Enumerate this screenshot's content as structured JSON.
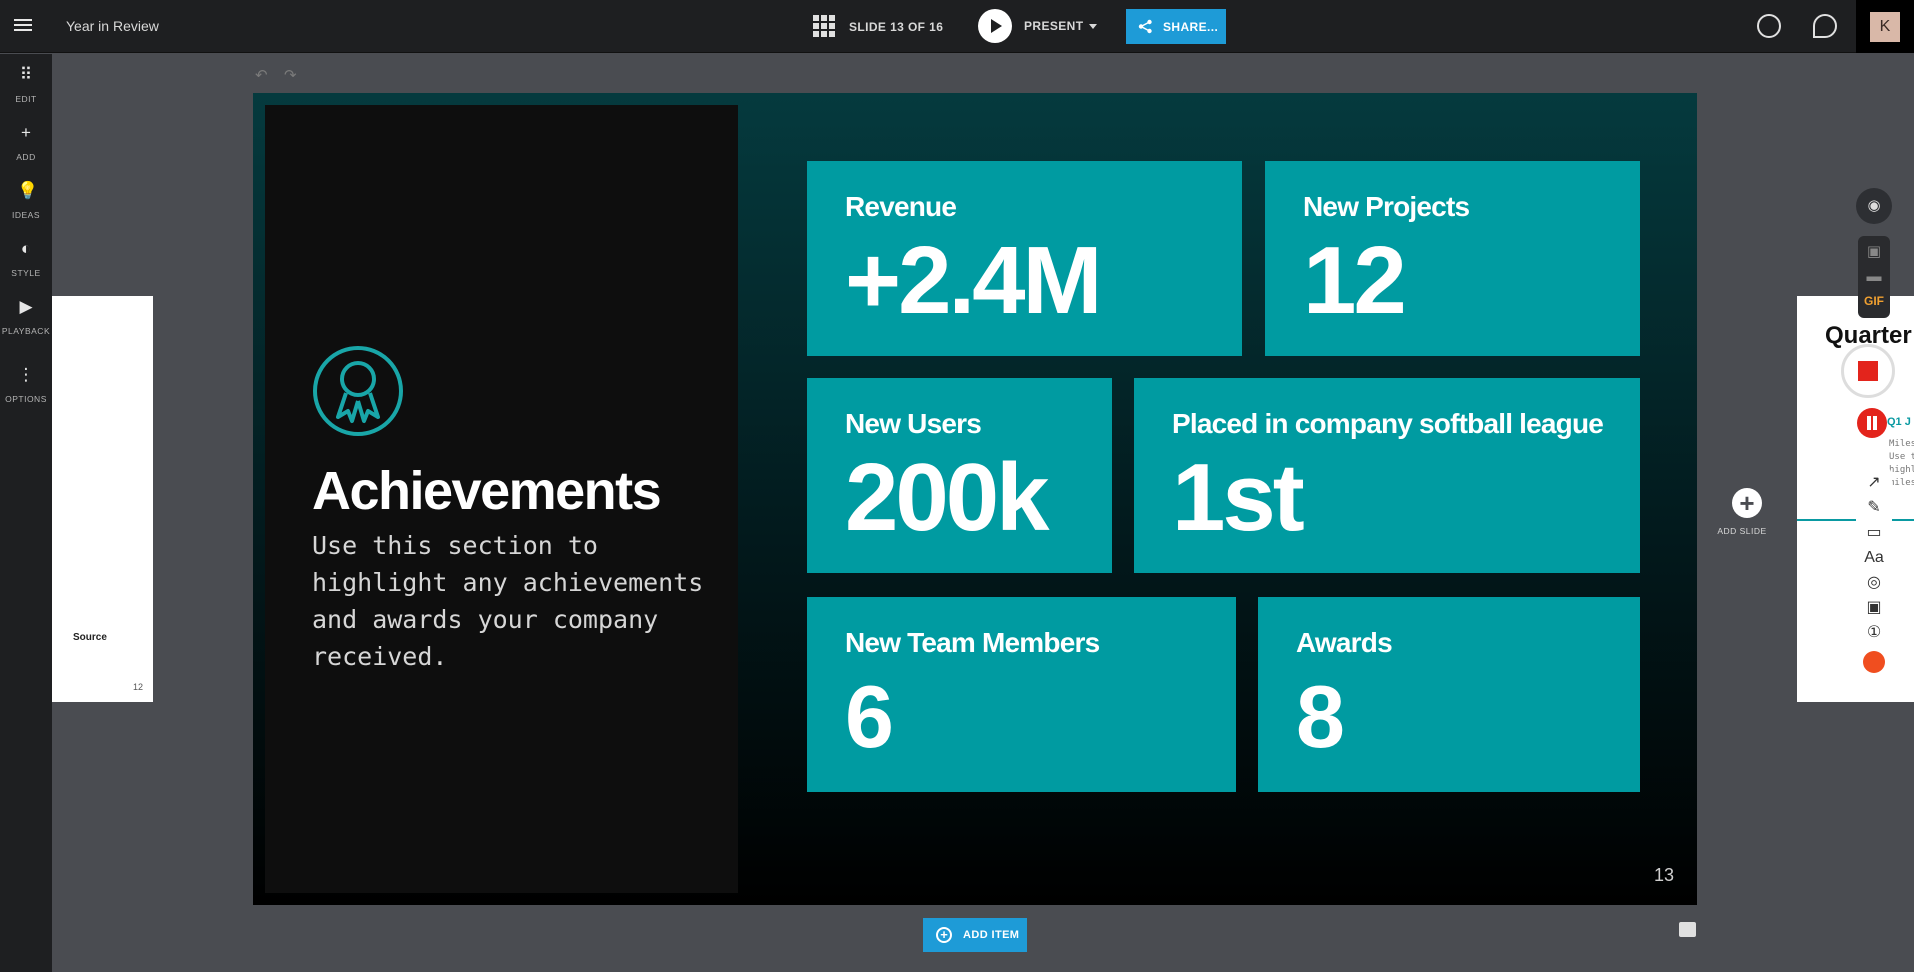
{
  "topbar": {
    "doc_title": "Year in Review",
    "slide_counter": "SLIDE 13 OF 16",
    "present_label": "PRESENT",
    "share_label": "SHARE...",
    "avatar_initial": "K"
  },
  "rail": {
    "items": [
      {
        "label": "EDIT",
        "icon": "edit-grid-icon"
      },
      {
        "label": "ADD",
        "icon": "plus-icon"
      },
      {
        "label": "IDEAS",
        "icon": "lightbulb-icon"
      },
      {
        "label": "STYLE",
        "icon": "palette-icon"
      },
      {
        "label": "PLAYBACK",
        "icon": "play-circle-icon"
      },
      {
        "label": "OPTIONS",
        "icon": "more-vertical-icon"
      }
    ]
  },
  "prev_thumb": {
    "source_label": "Source",
    "number": "12"
  },
  "next_thumb": {
    "title": "Quarter",
    "milestone_label": "Q1 J",
    "text": "Miles\nUse t\nhighl\nmiles"
  },
  "slide": {
    "title": "Achievements",
    "body": "Use this section to highlight any achievements and awards your company received.",
    "number": "13",
    "cards": [
      {
        "label": "Revenue",
        "value": "+2.4M"
      },
      {
        "label": "New Projects",
        "value": "12"
      },
      {
        "label": "New Users",
        "value": "200k"
      },
      {
        "label": "Placed in company softball league",
        "value": "1st"
      },
      {
        "label": "New Team Members",
        "value": "6"
      },
      {
        "label": "Awards",
        "value": "8"
      }
    ]
  },
  "add_slide_label": "ADD SLIDE",
  "add_item_label": "ADD ITEM",
  "recorder": {
    "gif_label": "GIF",
    "text_tool": "Aa"
  },
  "colors": {
    "accent": "#1e9bd7",
    "card": "#009ba1",
    "record": "#e3241c"
  }
}
